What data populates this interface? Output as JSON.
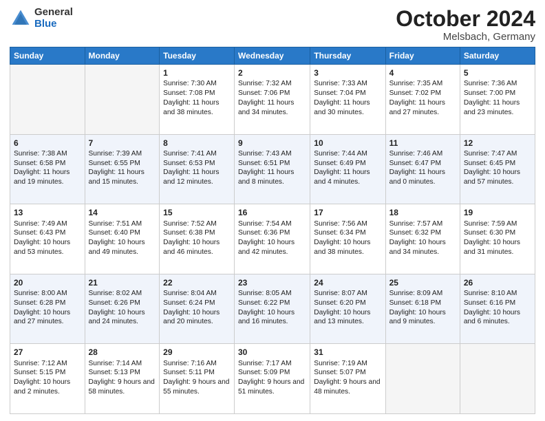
{
  "header": {
    "logo_general": "General",
    "logo_blue": "Blue",
    "month": "October 2024",
    "location": "Melsbach, Germany"
  },
  "weekdays": [
    "Sunday",
    "Monday",
    "Tuesday",
    "Wednesday",
    "Thursday",
    "Friday",
    "Saturday"
  ],
  "weeks": [
    [
      {
        "day": "",
        "info": ""
      },
      {
        "day": "",
        "info": ""
      },
      {
        "day": "1",
        "info": "Sunrise: 7:30 AM\nSunset: 7:08 PM\nDaylight: 11 hours and 38 minutes."
      },
      {
        "day": "2",
        "info": "Sunrise: 7:32 AM\nSunset: 7:06 PM\nDaylight: 11 hours and 34 minutes."
      },
      {
        "day": "3",
        "info": "Sunrise: 7:33 AM\nSunset: 7:04 PM\nDaylight: 11 hours and 30 minutes."
      },
      {
        "day": "4",
        "info": "Sunrise: 7:35 AM\nSunset: 7:02 PM\nDaylight: 11 hours and 27 minutes."
      },
      {
        "day": "5",
        "info": "Sunrise: 7:36 AM\nSunset: 7:00 PM\nDaylight: 11 hours and 23 minutes."
      }
    ],
    [
      {
        "day": "6",
        "info": "Sunrise: 7:38 AM\nSunset: 6:58 PM\nDaylight: 11 hours and 19 minutes."
      },
      {
        "day": "7",
        "info": "Sunrise: 7:39 AM\nSunset: 6:55 PM\nDaylight: 11 hours and 15 minutes."
      },
      {
        "day": "8",
        "info": "Sunrise: 7:41 AM\nSunset: 6:53 PM\nDaylight: 11 hours and 12 minutes."
      },
      {
        "day": "9",
        "info": "Sunrise: 7:43 AM\nSunset: 6:51 PM\nDaylight: 11 hours and 8 minutes."
      },
      {
        "day": "10",
        "info": "Sunrise: 7:44 AM\nSunset: 6:49 PM\nDaylight: 11 hours and 4 minutes."
      },
      {
        "day": "11",
        "info": "Sunrise: 7:46 AM\nSunset: 6:47 PM\nDaylight: 11 hours and 0 minutes."
      },
      {
        "day": "12",
        "info": "Sunrise: 7:47 AM\nSunset: 6:45 PM\nDaylight: 10 hours and 57 minutes."
      }
    ],
    [
      {
        "day": "13",
        "info": "Sunrise: 7:49 AM\nSunset: 6:43 PM\nDaylight: 10 hours and 53 minutes."
      },
      {
        "day": "14",
        "info": "Sunrise: 7:51 AM\nSunset: 6:40 PM\nDaylight: 10 hours and 49 minutes."
      },
      {
        "day": "15",
        "info": "Sunrise: 7:52 AM\nSunset: 6:38 PM\nDaylight: 10 hours and 46 minutes."
      },
      {
        "day": "16",
        "info": "Sunrise: 7:54 AM\nSunset: 6:36 PM\nDaylight: 10 hours and 42 minutes."
      },
      {
        "day": "17",
        "info": "Sunrise: 7:56 AM\nSunset: 6:34 PM\nDaylight: 10 hours and 38 minutes."
      },
      {
        "day": "18",
        "info": "Sunrise: 7:57 AM\nSunset: 6:32 PM\nDaylight: 10 hours and 34 minutes."
      },
      {
        "day": "19",
        "info": "Sunrise: 7:59 AM\nSunset: 6:30 PM\nDaylight: 10 hours and 31 minutes."
      }
    ],
    [
      {
        "day": "20",
        "info": "Sunrise: 8:00 AM\nSunset: 6:28 PM\nDaylight: 10 hours and 27 minutes."
      },
      {
        "day": "21",
        "info": "Sunrise: 8:02 AM\nSunset: 6:26 PM\nDaylight: 10 hours and 24 minutes."
      },
      {
        "day": "22",
        "info": "Sunrise: 8:04 AM\nSunset: 6:24 PM\nDaylight: 10 hours and 20 minutes."
      },
      {
        "day": "23",
        "info": "Sunrise: 8:05 AM\nSunset: 6:22 PM\nDaylight: 10 hours and 16 minutes."
      },
      {
        "day": "24",
        "info": "Sunrise: 8:07 AM\nSunset: 6:20 PM\nDaylight: 10 hours and 13 minutes."
      },
      {
        "day": "25",
        "info": "Sunrise: 8:09 AM\nSunset: 6:18 PM\nDaylight: 10 hours and 9 minutes."
      },
      {
        "day": "26",
        "info": "Sunrise: 8:10 AM\nSunset: 6:16 PM\nDaylight: 10 hours and 6 minutes."
      }
    ],
    [
      {
        "day": "27",
        "info": "Sunrise: 7:12 AM\nSunset: 5:15 PM\nDaylight: 10 hours and 2 minutes."
      },
      {
        "day": "28",
        "info": "Sunrise: 7:14 AM\nSunset: 5:13 PM\nDaylight: 9 hours and 58 minutes."
      },
      {
        "day": "29",
        "info": "Sunrise: 7:16 AM\nSunset: 5:11 PM\nDaylight: 9 hours and 55 minutes."
      },
      {
        "day": "30",
        "info": "Sunrise: 7:17 AM\nSunset: 5:09 PM\nDaylight: 9 hours and 51 minutes."
      },
      {
        "day": "31",
        "info": "Sunrise: 7:19 AM\nSunset: 5:07 PM\nDaylight: 9 hours and 48 minutes."
      },
      {
        "day": "",
        "info": ""
      },
      {
        "day": "",
        "info": ""
      }
    ]
  ]
}
